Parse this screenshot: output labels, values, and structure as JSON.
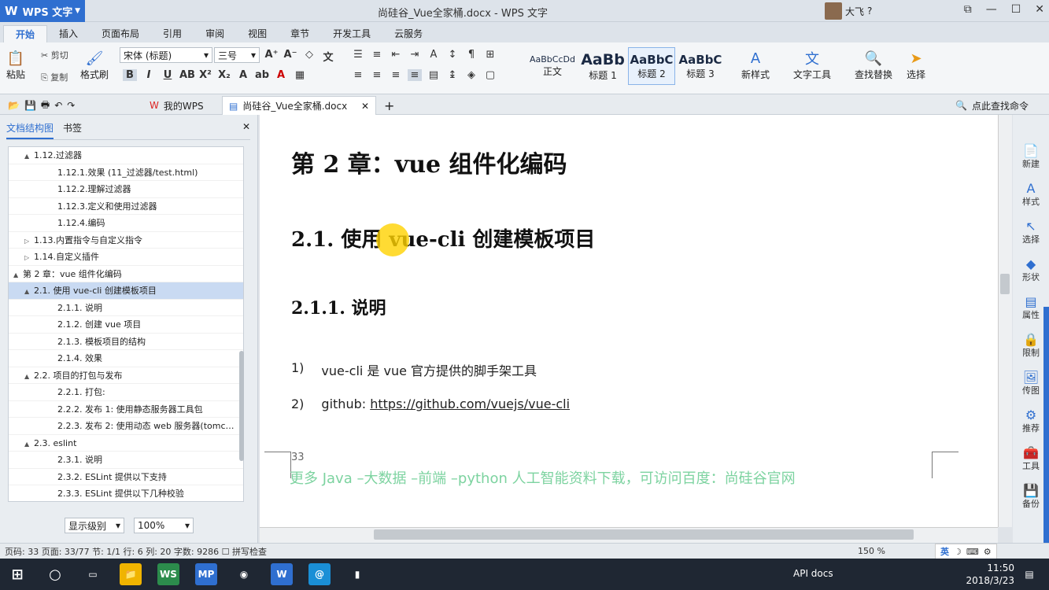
{
  "app": {
    "name": "WPS 文字",
    "window_title": "尚硅谷_Vue全家桶.docx - WPS 文字",
    "user": "大飞"
  },
  "ribbon_tabs": [
    "开始",
    "插入",
    "页面布局",
    "引用",
    "审阅",
    "视图",
    "章节",
    "开发工具",
    "云服务"
  ],
  "ribbon": {
    "paste": "粘贴",
    "cut": "剪切",
    "copy": "复制",
    "format_painter": "格式刷",
    "font": "宋体 (标题)",
    "size": "三号",
    "styles": [
      {
        "preview": "AaBbCcDd",
        "label": "正文"
      },
      {
        "preview": "AaBb",
        "label": "标题 1"
      },
      {
        "preview": "AaBbC",
        "label": "标题 2"
      },
      {
        "preview": "AaBbC",
        "label": "标题 3"
      }
    ],
    "new_style": "新样式",
    "text_tools": "文字工具",
    "find_replace": "查找替换",
    "select": "选择"
  },
  "doc_tabs": {
    "home": "我的WPS",
    "doc": "尚硅谷_Vue全家桶.docx",
    "search_cmd": "点此查找命令"
  },
  "nav": {
    "tab_structure": "文档结构图",
    "tab_bookmark": "书签",
    "items": [
      {
        "text": "1.12.过滤器",
        "level": "l2",
        "tri": "▲"
      },
      {
        "text": "1.12.1.效果 (11_过滤器/test.html)",
        "level": "l3",
        "tri": ""
      },
      {
        "text": "1.12.2.理解过滤器",
        "level": "l3",
        "tri": ""
      },
      {
        "text": "1.12.3.定义和使用过滤器",
        "level": "l3",
        "tri": ""
      },
      {
        "text": "1.12.4.编码",
        "level": "l3",
        "tri": ""
      },
      {
        "text": "1.13.内置指令与自定义指令",
        "level": "l2",
        "tri": "▷"
      },
      {
        "text": "1.14.自定义插件",
        "level": "l2",
        "tri": "▷"
      },
      {
        "text": "第 2 章：vue 组件化编码",
        "level": "l1",
        "tri": "▲"
      },
      {
        "text": "2.1. 使用 vue-cli 创建模板项目",
        "level": "l2",
        "tri": "▲",
        "hl": true
      },
      {
        "text": "2.1.1. 说明",
        "level": "l3",
        "tri": ""
      },
      {
        "text": "2.1.2. 创建 vue 项目",
        "level": "l3",
        "tri": ""
      },
      {
        "text": "2.1.3. 模板项目的结构",
        "level": "l3",
        "tri": ""
      },
      {
        "text": "2.1.4. 效果",
        "level": "l3",
        "tri": ""
      },
      {
        "text": "2.2. 项目的打包与发布",
        "level": "l2",
        "tri": "▲"
      },
      {
        "text": "2.2.1. 打包:",
        "level": "l3",
        "tri": ""
      },
      {
        "text": "2.2.2. 发布 1: 使用静态服务器工具包",
        "level": "l3",
        "tri": ""
      },
      {
        "text": "2.2.3. 发布 2: 使用动态 web 服务器(tomc…",
        "level": "l3",
        "tri": ""
      },
      {
        "text": "2.3. eslint",
        "level": "l2",
        "tri": "▲"
      },
      {
        "text": "2.3.1. 说明",
        "level": "l3",
        "tri": ""
      },
      {
        "text": "2.3.2.  ESLint 提供以下支持",
        "level": "l3",
        "tri": ""
      },
      {
        "text": "2.3.3. ESLint 提供以下几种校验",
        "level": "l3",
        "tri": ""
      }
    ],
    "level_select": "显示级别",
    "zoom_select": "100%"
  },
  "doc": {
    "h1": "第 2 章：vue 组件化编码",
    "h2": "2.1.  使用 vue-cli 创建模板项目",
    "h3": "2.1.1.  说明",
    "list": [
      {
        "num": "1)",
        "text": "vue-cli 是 vue 官方提供的脚手架工具",
        "link": ""
      },
      {
        "num": "2)",
        "text": "github: ",
        "link": "https://github.com/vuejs/vue-cli"
      }
    ],
    "page_number": "33",
    "footer": "更多 Java –大数据 –前端 –python 人工智能资料下载，可访问百度：尚硅谷官网"
  },
  "right_panel": [
    "新建",
    "样式",
    "选择",
    "形状",
    "属性",
    "限制",
    "传图",
    "推荐",
    "工具",
    "备份"
  ],
  "status": {
    "page_code": "页码: 33",
    "page": "页面: 33/77",
    "section": "节: 1/1",
    "row": "行: 6",
    "col": "列: 20",
    "words": "字数: 9286",
    "spell": "拼写检查",
    "zoom": "150 %",
    "ime": "英"
  },
  "taskbar": {
    "api_docs": "API docs",
    "time": "11:50",
    "date": "2018/3/23"
  }
}
